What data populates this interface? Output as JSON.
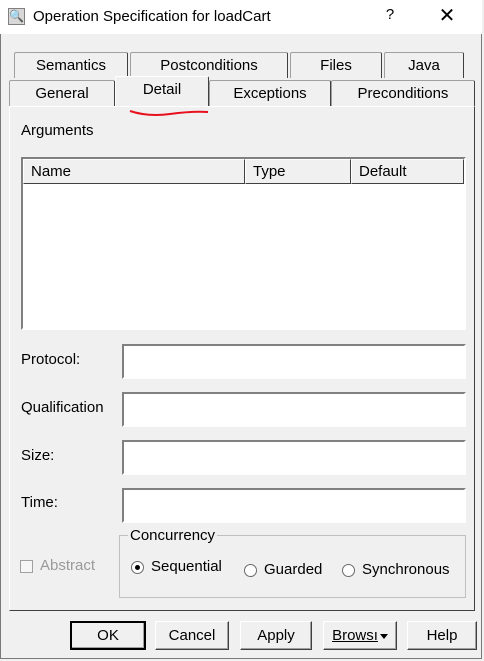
{
  "window": {
    "title": "Operation Specification for loadCart",
    "help_glyph": "?",
    "close_glyph": "✕"
  },
  "tabs_back": [
    "Semantics",
    "Postconditions",
    "Files",
    "Java"
  ],
  "tabs_front": [
    "General",
    "Detail",
    "Exceptions",
    "Preconditions"
  ],
  "active_tab": "Detail",
  "arguments": {
    "label": "Arguments",
    "columns": [
      "Name",
      "Type",
      "Default"
    ],
    "rows": []
  },
  "fields": {
    "protocol_label": "Protocol:",
    "protocol_value": "",
    "qualification_label": "Qualification",
    "qualification_value": "",
    "size_label": "Size:",
    "size_value": "",
    "time_label": "Time:",
    "time_value": ""
  },
  "abstract_label": "Abstract",
  "concurrency": {
    "label": "Concurrency",
    "options": [
      "Sequential",
      "Guarded",
      "Synchronous"
    ],
    "selected": "Sequential"
  },
  "buttons": {
    "ok": "OK",
    "cancel": "Cancel",
    "apply": "Apply",
    "browse": "Browsı",
    "help": "Help"
  },
  "colors": {
    "annotation_underline": "#e8101f"
  }
}
